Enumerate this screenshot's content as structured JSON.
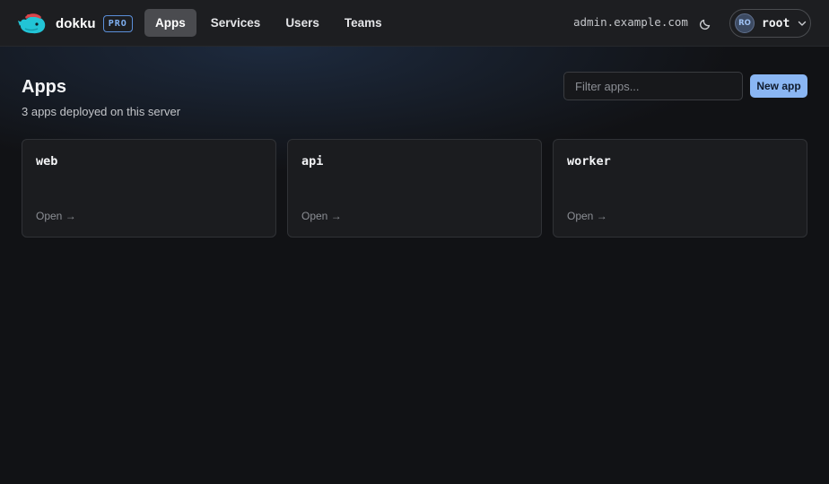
{
  "header": {
    "brand": "dokku",
    "badge": "PRO",
    "nav": [
      {
        "label": "Apps",
        "active": true
      },
      {
        "label": "Services",
        "active": false
      },
      {
        "label": "Users",
        "active": false
      },
      {
        "label": "Teams",
        "active": false
      }
    ],
    "host": "admin.example.com",
    "theme_icon": "moon-icon",
    "user": {
      "initials": "RO",
      "name": "root"
    }
  },
  "main": {
    "title": "Apps",
    "subtitle": "3 apps deployed on this server",
    "filter_placeholder": "Filter apps...",
    "new_app_label": "New app",
    "apps": [
      {
        "name": "web",
        "action": "Open →"
      },
      {
        "name": "api",
        "action": "Open →"
      },
      {
        "name": "worker",
        "action": "Open →"
      }
    ]
  },
  "colors": {
    "background": "#111215",
    "topbar": "#1d1e21",
    "accent": "#8ab6f3",
    "card": "#1b1c1f"
  }
}
